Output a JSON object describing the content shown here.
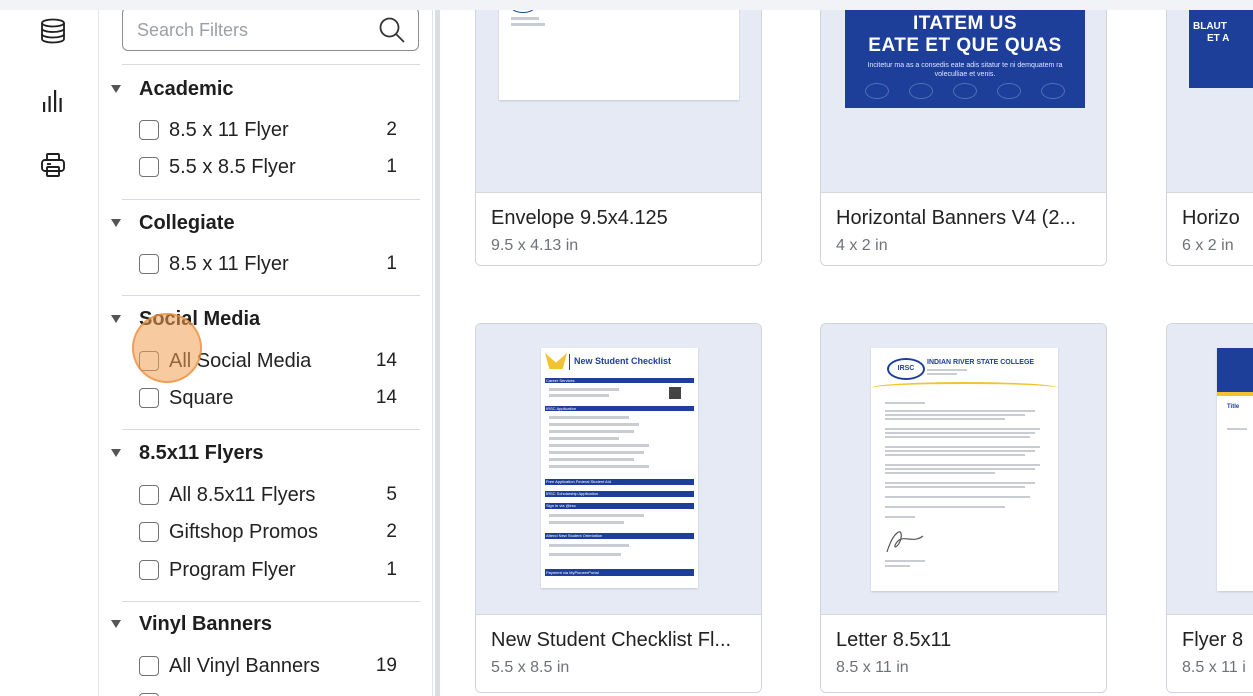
{
  "search": {
    "placeholder": "Search Filters"
  },
  "rail": {
    "icons": [
      "database-icon",
      "bar-chart-icon",
      "printer-icon"
    ]
  },
  "filters": {
    "groups": [
      {
        "title": "Academic",
        "options": [
          {
            "label": "8.5 x 11 Flyer",
            "count": "2"
          },
          {
            "label": "5.5 x 8.5 Flyer",
            "count": "1"
          }
        ]
      },
      {
        "title": "Collegiate",
        "options": [
          {
            "label": "8.5 x 11 Flyer",
            "count": "1"
          }
        ]
      },
      {
        "title": "Social Media",
        "options": [
          {
            "label": "All Social Media",
            "count": "14"
          },
          {
            "label": "Square",
            "count": "14"
          }
        ]
      },
      {
        "title": "8.5x11 Flyers",
        "options": [
          {
            "label": "All 8.5x11 Flyers",
            "count": "5"
          },
          {
            "label": "Giftshop Promos",
            "count": "2"
          },
          {
            "label": "Program Flyer",
            "count": "1"
          }
        ]
      },
      {
        "title": "Vinyl Banners",
        "options": [
          {
            "label": "All Vinyl Banners",
            "count": "19"
          }
        ]
      }
    ]
  },
  "cards": [
    {
      "title": "Envelope 9.5x4.125",
      "size": "9.5 x 4.13 in"
    },
    {
      "title": "Horizontal Banners V4 (2...",
      "size": "4 x 2 in"
    },
    {
      "title": "Horizo",
      "size": "6 x 2 in"
    },
    {
      "title": "New Student Checklist Fl...",
      "size": "5.5 x 8.5 in"
    },
    {
      "title": "Letter 8.5x11",
      "size": "8.5 x 11 in"
    },
    {
      "title": "Flyer 8",
      "size": "8.5 x 11 i"
    }
  ],
  "thumbs": {
    "banner_line1": "ITATEM US",
    "banner_line2": "EATE ET QUE QUAS",
    "banner_sub": "Incitetur ma as a consedis eate adis sitatur te ni demquatem ra voleculliae et venis.",
    "banner3_line1": "BLAUT",
    "banner3_line2": "ET A",
    "checklist_header": "New Student Checklist",
    "checklist_sections": [
      "Career Services",
      "IRSC Application",
      "Free Application Federal Student Aid",
      "IRSC Scholarship Application",
      "Sign in via @irsc",
      "Attend New Student Orientation",
      "Payment via MyPioneerPortal"
    ],
    "letter_org": "INDIAN RIVER STATE COLLEGE",
    "logo_text": "IRSC",
    "flyer3_label": "Title"
  },
  "colors": {
    "accent": "#1d3f9a",
    "thumb_bg": "#e6eaf4",
    "pointer": "#f0a050"
  }
}
